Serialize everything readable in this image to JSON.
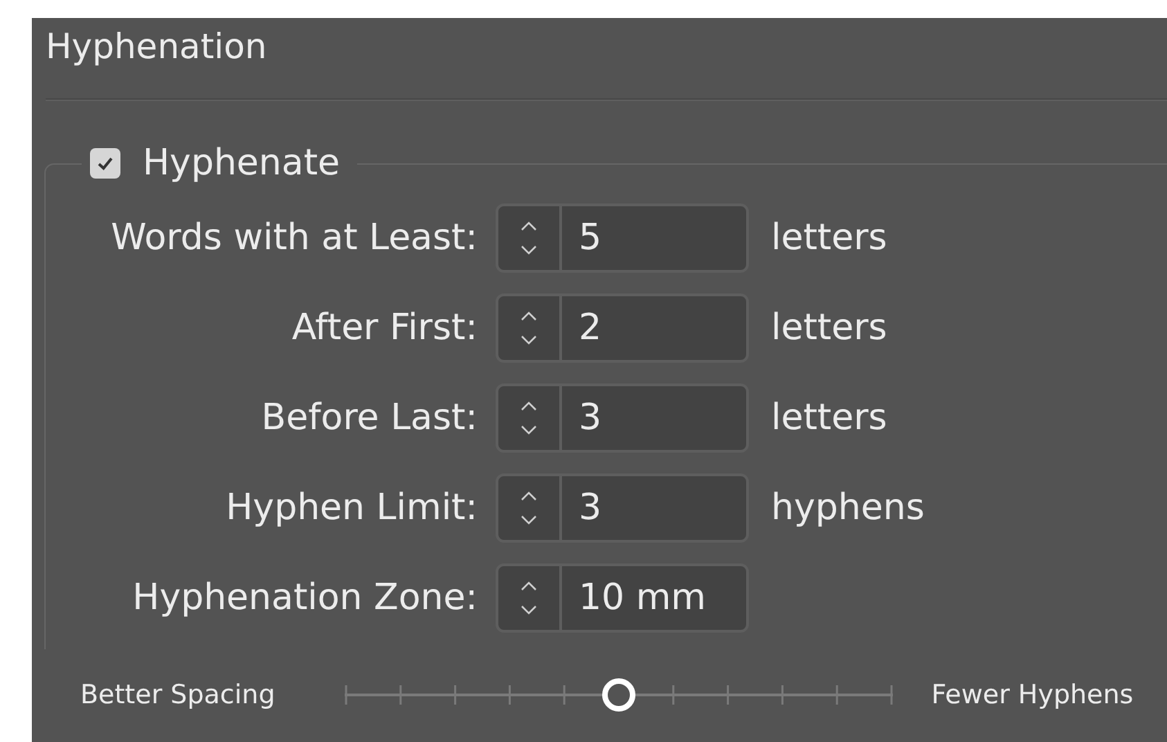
{
  "panel": {
    "title": "Hyphenation"
  },
  "hyphenate": {
    "label": "Hyphenate",
    "checked": true
  },
  "fields": [
    {
      "label": "Words with at Least:",
      "value": "5",
      "unit": "letters"
    },
    {
      "label": "After First:",
      "value": "2",
      "unit": "letters"
    },
    {
      "label": "Before Last:",
      "value": "3",
      "unit": "letters"
    },
    {
      "label": "Hyphen Limit:",
      "value": "3",
      "unit": "hyphens"
    },
    {
      "label": "Hyphenation Zone:",
      "value": "10 mm"
    }
  ],
  "slider": {
    "left_label": "Better Spacing",
    "right_label": "Fewer Hyphens",
    "level": 0.5
  }
}
